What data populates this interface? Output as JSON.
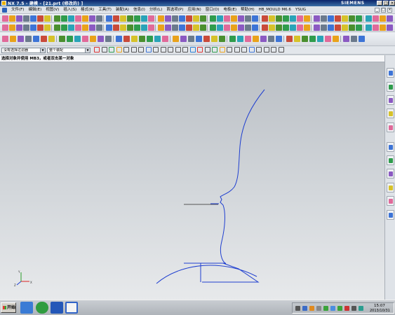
{
  "window": {
    "title": "NX 7.5 - 建模 - [21.prt (修改的) ]",
    "brand": "SIEMENS",
    "minimize": "_",
    "maximize": "□",
    "close": "×"
  },
  "menu": {
    "items": [
      "文件(F)",
      "编辑(E)",
      "视图(V)",
      "插入(S)",
      "格式(R)",
      "工具(T)",
      "装配(A)",
      "信息(I)",
      "分析(L)",
      "首选项(P)",
      "应用(N)",
      "窗口(O)",
      "电极(E)",
      "帮助(H)",
      "HB_MOULD M6.6",
      "YSUG"
    ],
    "doc_buttons": [
      "_",
      "□",
      "×"
    ]
  },
  "selection_bar": {
    "filter_value": "没有选择过滤器",
    "scope_value": "整个装配"
  },
  "cue_line": {
    "text": "选择对象并使用 MB3，或者双击某一对象"
  },
  "graphics": {
    "background_top": "#b9bec4",
    "background_bottom": "#e7e9eb",
    "curve_color": "#1f3fd0",
    "triad_axes": [
      "X",
      "Y",
      "Z"
    ]
  },
  "taskbar": {
    "start_label": "开始",
    "clock_time": "15:07",
    "clock_date": "2013/10/31"
  },
  "icons": {
    "resource_tabs": [
      "assembly-navigator-icon",
      "constraint-navigator-icon",
      "part-navigator-icon",
      "reuse-library-icon",
      "history-icon",
      "process-studio-icon",
      "roles-icon",
      "system-materials-icon",
      "visualization-icon",
      "web-browser-icon",
      "palette-icon"
    ]
  }
}
